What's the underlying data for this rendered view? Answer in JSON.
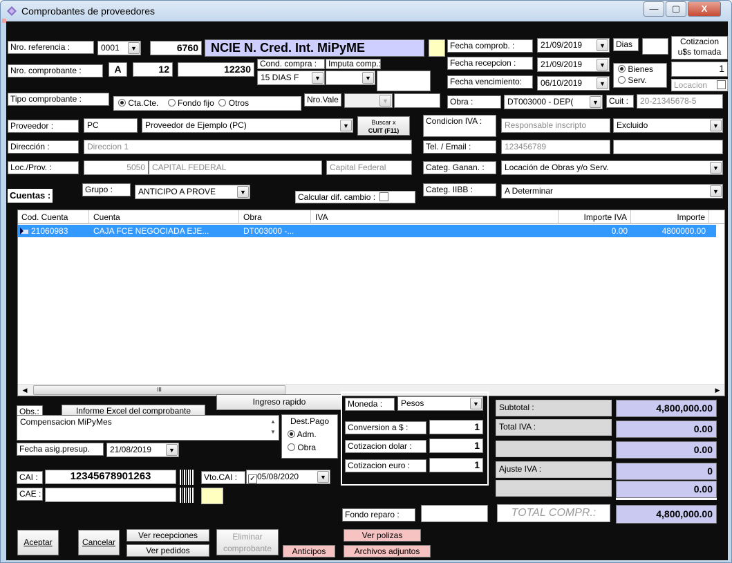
{
  "window": {
    "title": "Comprobantes de proveedores",
    "min": "—",
    "max": "▢",
    "close": "X"
  },
  "header": {
    "nro_referencia_label": "Nro. referencia :",
    "nro_referencia_serie": "0001",
    "nro_referencia_num": "6760",
    "tipo_titulo": "NCIE  N. Cred. Int. MiPyME",
    "nro_comprobante_label": "Nro. comprobante :",
    "nro_comprobante_letra": "A",
    "nro_comprobante_pv": "12",
    "nro_comprobante_num": "12230",
    "cond_compra_label": "Cond. compra :",
    "cond_compra_value": "15 DIAS F",
    "imputa_comp_label": "Imputa comp.:",
    "imputa_comp_value": "",
    "tipo_comprobante_label": "Tipo comprobante :",
    "tipo_opt_cta": "Cta.Cte.",
    "tipo_opt_fondo": "Fondo fijo",
    "tipo_opt_otros": "Otros",
    "nro_vale_label": "Nro.Vale",
    "fecha_comprob_label": "Fecha comprob. :",
    "fecha_comprob_value": "21/09/2019",
    "fecha_recepcion_label": "Fecha recepcion :",
    "fecha_recepcion_value": "21/09/2019",
    "fecha_venc_label": "Fecha vencimiento:",
    "fecha_venc_value": "06/10/2019",
    "dias_label": "Dias",
    "cotizacion_label_1": "Cotizacion",
    "cotizacion_label_2": "u$s tomada",
    "cotizacion_value": "1",
    "opt_bienes": "Bienes",
    "opt_serv": "Serv.",
    "locacion_label": "Locacion",
    "obra_label": "Obra :",
    "obra_value": "DT003000 - DEP(",
    "cuit_label": "Cuit :",
    "cuit_value": "20-21345678-5"
  },
  "proveedor": {
    "label": "Proveedor :",
    "code": "PC",
    "name": "Proveedor de Ejemplo (PC)",
    "buscar_btn_1": "Buscar x",
    "buscar_btn_2": "CUIT (F11)",
    "cond_iva_label": "Condicion IVA :",
    "cond_iva_value": "Responsable inscripto",
    "cond_iva_select": "Excluido",
    "direccion_label": "Dirección :",
    "direccion_value": "Direccion 1",
    "tel_label": "Tel. / Email :",
    "tel_value": "123456789",
    "email_value": "",
    "loc_label": "Loc./Prov. :",
    "cp_value": "5050",
    "localidad_value": "CAPITAL FEDERAL",
    "provincia_value": "Capital Federal",
    "categ_ganan_label": "Categ. Ganan. :",
    "categ_ganan_value": "Locación de Obras y/o Serv.",
    "categ_iibb_label": "Categ. IIBB :",
    "categ_iibb_value": "A Determinar"
  },
  "cuentas": {
    "title": "Cuentas :",
    "grupo_label": "Grupo :",
    "grupo_value": "ANTICIPO A PROVE",
    "calcular_label": "Calcular dif. cambio :",
    "columns": [
      "Cod. Cuenta",
      "Cuenta",
      "Obra",
      "IVA",
      "Importe IVA",
      "Importe"
    ],
    "rows": [
      {
        "cod": "21060983",
        "cuenta": "CAJA FCE NEGOCIADA EJE...",
        "obra": "DT003000 -...",
        "iva": "",
        "importe_iva": "0.00",
        "importe": "4800000.00"
      }
    ],
    "scroll_grip": "III"
  },
  "bottom": {
    "obs_label": "Obs.:",
    "informe_btn": "Informe Excel del comprobante",
    "ingreso_btn": "Ingreso rapido",
    "obs_value": "Compensacion MiPyMes",
    "dest_pago_label": "Dest.Pago",
    "opt_adm": "Adm.",
    "opt_obra": "Obra",
    "fecha_asig_label": "Fecha asig.presup.",
    "fecha_asig_value": "21/08/2019",
    "cai_label": "CAI :",
    "cai_value": "12345678901263",
    "vto_cai_label": "Vto.CAI :",
    "vto_cai_value": "05/08/2020",
    "cae_label": "CAE :",
    "cae_value": "",
    "moneda_label": "Moneda :",
    "moneda_value": "Pesos",
    "conversion_label": "Conversion a $ :",
    "conversion_value": "1",
    "cot_dolar_label": "Cotizacion dolar :",
    "cot_dolar_value": "1",
    "cot_euro_label": "Cotizacion euro :",
    "cot_euro_value": "1",
    "fondo_reparo_label": "Fondo reparo :",
    "subtotal_label": "Subtotal :",
    "subtotal_value": "4,800,000.00",
    "total_iva_label": "Total IVA :",
    "total_iva_value": "0.00",
    "blank1_value": "0.00",
    "ajuste_iva_label": "Ajuste IVA :",
    "ajuste_iva_value": "0",
    "blank2_value": "0.00",
    "total_label": "TOTAL COMPR.:",
    "total_value": "4,800,000.00",
    "aceptar_btn": "Aceptar",
    "cancelar_btn": "Cancelar",
    "ver_recepciones_btn": "Ver recepciones",
    "ver_pedidos_btn": "Ver pedidos",
    "eliminar_btn_1": "Eliminar",
    "eliminar_btn_2": "comprobante",
    "anticipos_btn": "Anticipos",
    "ver_polizas_btn": "Ver polizas",
    "archivos_btn": "Archivos adjuntos"
  },
  "colors": {
    "selection": "#3399ff",
    "total_bg": "#c9c9f2",
    "pink_btn": "#f7c2c2",
    "yellow_box": "#ffffc0",
    "background": "#0d0d0d"
  }
}
